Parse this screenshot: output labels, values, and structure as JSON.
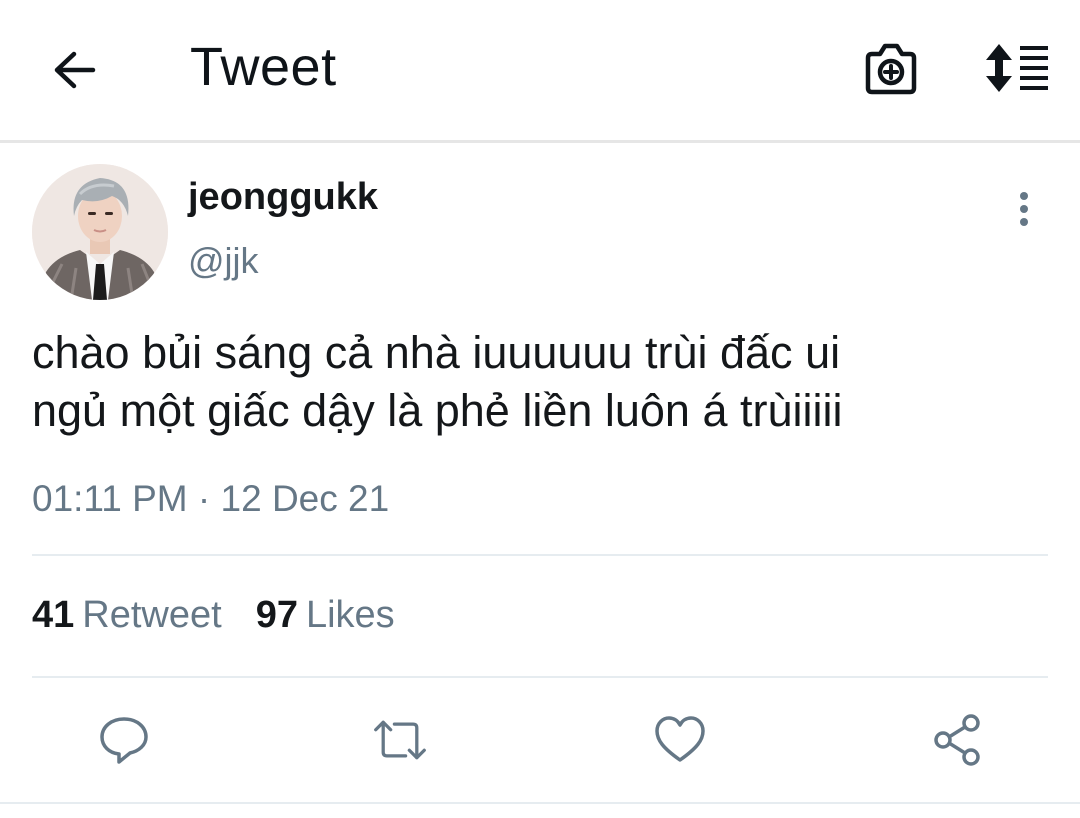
{
  "header": {
    "title": "Tweet",
    "back_icon": "arrow-left-icon",
    "camera_icon": "camera-plus-icon",
    "sort_icon": "sort-lines-icon"
  },
  "tweet": {
    "display_name": "jeonggukk",
    "handle": "@jjk",
    "text_lines": [
      "chào bủi sáng cả nhà iuuuuuu trùi đấc ui",
      "ngủ một giấc dậy là phẻ liền luôn á trùiiiii"
    ],
    "timestamp": "01:11 PM · 12 Dec 21"
  },
  "stats": {
    "retweets_count": "41",
    "retweets_label": "Retweet",
    "likes_count": "97",
    "likes_label": "Likes"
  },
  "actions": [
    "reply-icon",
    "retweet-icon",
    "like-icon",
    "share-icon"
  ],
  "colors": {
    "text_primary": "#14171a",
    "text_secondary": "#657786",
    "divider": "#e6ecf0"
  }
}
